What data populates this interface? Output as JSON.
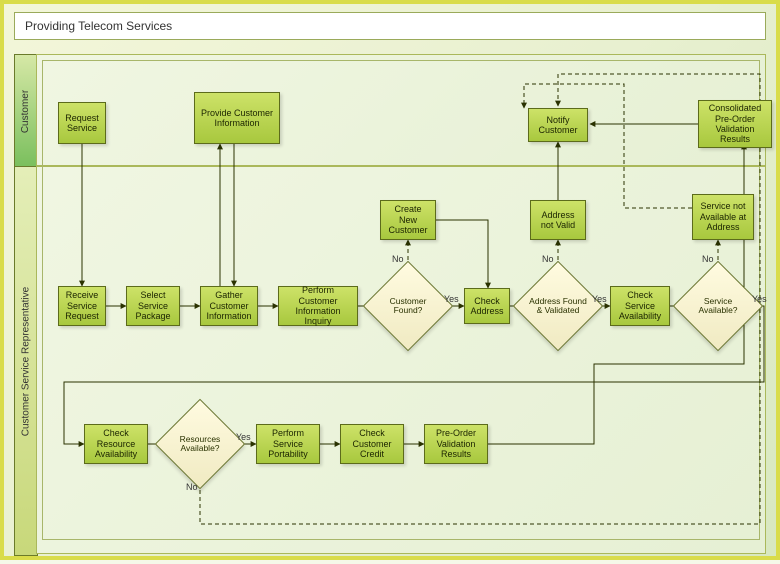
{
  "title": "Providing Telecom Services",
  "lanes": {
    "customer": "Customer",
    "csr": "Customer Service Representative"
  },
  "nodes": {
    "request_service": "Request Service",
    "provide_customer_info": "Provide Customer Information",
    "notify_customer": "Notify Customer",
    "consolidated_results": "Consolidated Pre-Order Validation Results",
    "receive_service_request": "Receive Service Request",
    "select_service_package": "Select Service Package",
    "gather_customer_info": "Gather Customer Information",
    "perform_info_inquiry": "Perform Customer Information Inquiry",
    "customer_found": "Customer Found?",
    "create_new_customer": "Create New Customer",
    "check_address": "Check Address",
    "address_found_validated": "Address Found & Validated",
    "address_not_valid": "Address not Valid",
    "check_service_availability": "Check Service Availability",
    "service_available": "Service Available?",
    "service_not_available": "Service not Available at Address",
    "check_resource_availability": "Check Resource Availability",
    "resources_available": "Resources Available?",
    "perform_service_portability": "Perform Service Portability",
    "check_customer_credit": "Check Customer Credit",
    "pre_order_validation": "Pre-Order Validation Results"
  },
  "edge_labels": {
    "yes": "Yes",
    "no": "No"
  },
  "chart_data": {
    "type": "swimlane-flowchart",
    "title": "Providing Telecom Services",
    "lanes": [
      {
        "id": "customer",
        "label": "Customer"
      },
      {
        "id": "csr",
        "label": "Customer Service Representative"
      }
    ],
    "nodes": [
      {
        "id": "request_service",
        "lane": "customer",
        "type": "process",
        "label": "Request Service"
      },
      {
        "id": "provide_customer_info",
        "lane": "customer",
        "type": "process",
        "label": "Provide Customer Information"
      },
      {
        "id": "notify_customer",
        "lane": "customer",
        "type": "process",
        "label": "Notify Customer"
      },
      {
        "id": "consolidated_results",
        "lane": "customer",
        "type": "process",
        "label": "Consolidated Pre-Order Validation Results"
      },
      {
        "id": "receive_service_request",
        "lane": "csr",
        "type": "process",
        "label": "Receive Service Request"
      },
      {
        "id": "select_service_package",
        "lane": "csr",
        "type": "process",
        "label": "Select Service Package"
      },
      {
        "id": "gather_customer_info",
        "lane": "csr",
        "type": "process",
        "label": "Gather Customer Information"
      },
      {
        "id": "perform_info_inquiry",
        "lane": "csr",
        "type": "process",
        "label": "Perform Customer Information Inquiry"
      },
      {
        "id": "customer_found",
        "lane": "csr",
        "type": "decision",
        "label": "Customer Found?"
      },
      {
        "id": "create_new_customer",
        "lane": "csr",
        "type": "process",
        "label": "Create New Customer"
      },
      {
        "id": "check_address",
        "lane": "csr",
        "type": "process",
        "label": "Check Address"
      },
      {
        "id": "address_found_validated",
        "lane": "csr",
        "type": "decision",
        "label": "Address Found & Validated"
      },
      {
        "id": "address_not_valid",
        "lane": "csr",
        "type": "process",
        "label": "Address not Valid"
      },
      {
        "id": "check_service_availability",
        "lane": "csr",
        "type": "process",
        "label": "Check Service Availability"
      },
      {
        "id": "service_available",
        "lane": "csr",
        "type": "decision",
        "label": "Service Available?"
      },
      {
        "id": "service_not_available",
        "lane": "csr",
        "type": "process",
        "label": "Service not Available at Address"
      },
      {
        "id": "check_resource_availability",
        "lane": "csr",
        "type": "process",
        "label": "Check Resource Availability"
      },
      {
        "id": "resources_available",
        "lane": "csr",
        "type": "decision",
        "label": "Resources Available?"
      },
      {
        "id": "perform_service_portability",
        "lane": "csr",
        "type": "process",
        "label": "Perform Service Portability"
      },
      {
        "id": "check_customer_credit",
        "lane": "csr",
        "type": "process",
        "label": "Check Customer Credit"
      },
      {
        "id": "pre_order_validation",
        "lane": "csr",
        "type": "process",
        "label": "Pre-Order Validation Results"
      }
    ],
    "edges": [
      {
        "from": "request_service",
        "to": "receive_service_request"
      },
      {
        "from": "receive_service_request",
        "to": "select_service_package"
      },
      {
        "from": "select_service_package",
        "to": "gather_customer_info"
      },
      {
        "from": "gather_customer_info",
        "to": "provide_customer_info"
      },
      {
        "from": "provide_customer_info",
        "to": "gather_customer_info"
      },
      {
        "from": "gather_customer_info",
        "to": "perform_info_inquiry"
      },
      {
        "from": "perform_info_inquiry",
        "to": "customer_found"
      },
      {
        "from": "customer_found",
        "to": "create_new_customer",
        "label": "No",
        "style": "dashed"
      },
      {
        "from": "customer_found",
        "to": "check_address",
        "label": "Yes"
      },
      {
        "from": "create_new_customer",
        "to": "check_address"
      },
      {
        "from": "check_address",
        "to": "address_found_validated"
      },
      {
        "from": "address_found_validated",
        "to": "address_not_valid",
        "label": "No",
        "style": "dashed"
      },
      {
        "from": "address_found_validated",
        "to": "check_service_availability",
        "label": "Yes"
      },
      {
        "from": "address_not_valid",
        "to": "notify_customer"
      },
      {
        "from": "check_service_availability",
        "to": "service_available"
      },
      {
        "from": "service_available",
        "to": "service_not_available",
        "label": "No",
        "style": "dashed"
      },
      {
        "from": "service_not_available",
        "to": "notify_customer",
        "style": "dashed"
      },
      {
        "from": "service_available",
        "to": "check_resource_availability",
        "label": "Yes"
      },
      {
        "from": "check_resource_availability",
        "to": "resources_available"
      },
      {
        "from": "resources_available",
        "to": "perform_service_portability",
        "label": "Yes"
      },
      {
        "from": "resources_available",
        "to": "notify_customer",
        "label": "No",
        "style": "dashed"
      },
      {
        "from": "perform_service_portability",
        "to": "check_customer_credit"
      },
      {
        "from": "check_customer_credit",
        "to": "pre_order_validation"
      },
      {
        "from": "pre_order_validation",
        "to": "consolidated_results"
      },
      {
        "from": "consolidated_results",
        "to": "notify_customer"
      }
    ]
  }
}
